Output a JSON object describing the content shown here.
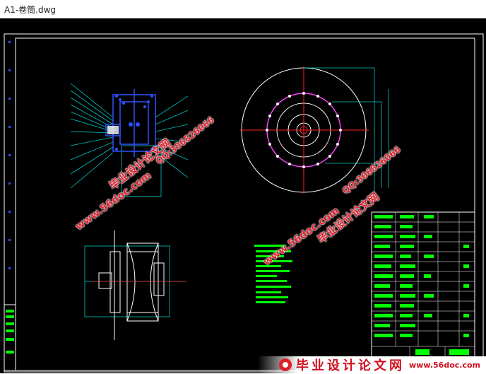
{
  "window": {
    "title": "A1-卷筒.dwg"
  },
  "watermarks": [
    {
      "text": "www.56doc.com",
      "color": "#e0202c"
    },
    {
      "text": "毕业设计论文网",
      "color": "#e0202c"
    },
    {
      "text": "QQ:306826066",
      "color": "#e0202c"
    },
    {
      "text": "www.56doc.com",
      "color": "#e0202c"
    },
    {
      "text": "毕业设计论文网",
      "color": "#e0202c"
    },
    {
      "text": "QQ:306826066",
      "color": "#e0202c"
    }
  ],
  "banner": {
    "site_name": "毕业设计论文网",
    "url": "www.56doc.com",
    "logo": "site-logo-icon"
  },
  "colors": {
    "canvas": "#000000",
    "frame": "#ffffff",
    "green_layer": "#00ff00",
    "cyan_layer": "#00c8c8",
    "blue_layer": "#3050ff",
    "red_layer": "#ff2020",
    "magenta_layer": "#ff40ff"
  }
}
